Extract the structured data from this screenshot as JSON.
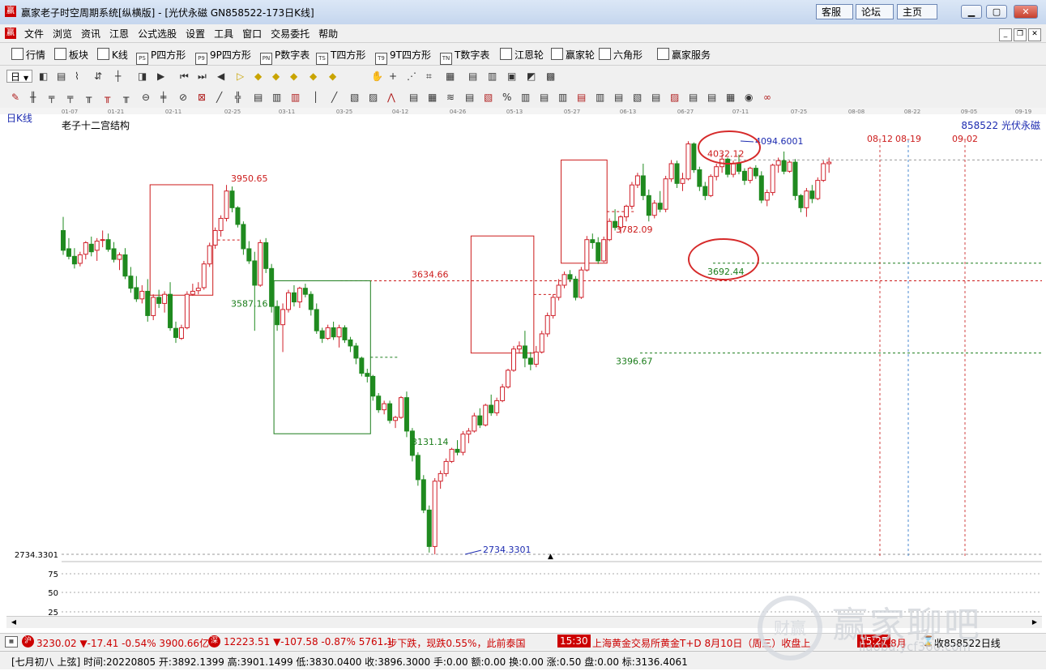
{
  "window": {
    "title": "赢家老子时空周期系统[纵横版] - [光伏永磁   GN858522-173日K线]",
    "logo_text": "赢",
    "buttons": [
      "客服",
      "论坛",
      "主页"
    ]
  },
  "menu": {
    "items": [
      "文件",
      "浏览",
      "资讯",
      "江恩",
      "公式选股",
      "设置",
      "工具",
      "窗口",
      "交易委托",
      "帮助"
    ]
  },
  "toolbar1": {
    "items": [
      {
        "label": "行情",
        "icon": "grid-icon"
      },
      {
        "label": "板块",
        "icon": "blocks-icon"
      },
      {
        "label": "K线",
        "icon": "candlestick-icon"
      },
      {
        "label": "P四方形",
        "icon": "ps-icon",
        "ic": "PS"
      },
      {
        "label": "9P四方形",
        "icon": "p9-icon",
        "ic": "P9"
      },
      {
        "label": "P数字表",
        "icon": "pn-icon",
        "ic": "PN"
      },
      {
        "label": "T四方形",
        "icon": "ts-icon",
        "ic": "TS"
      },
      {
        "label": "9T四方形",
        "icon": "t9-icon",
        "ic": "T9"
      },
      {
        "label": "T数字表",
        "icon": "tn-icon",
        "ic": "TN"
      },
      {
        "label": "江恩轮",
        "icon": "gann-wheel-icon"
      },
      {
        "label": "赢家轮",
        "icon": "winner-wheel-icon"
      },
      {
        "label": "六角形",
        "icon": "hexagon-icon"
      },
      {
        "label": "赢家服务",
        "icon": "dollar-icon"
      }
    ]
  },
  "toolbar2": {
    "period_label": "日"
  },
  "chart": {
    "period_label": "日K线",
    "structure_title": "老子十二宫结构",
    "stock_label": "858522 光伏永磁",
    "date_ticks": [
      "01-07",
      "01-21",
      "02-11",
      "02-25",
      "03-11",
      "03-25",
      "04-12",
      "04-26",
      "05-13",
      "05-27",
      "06-13",
      "06-27",
      "07-11",
      "07-25",
      "08-08",
      "08-22",
      "09-05",
      "09-19"
    ],
    "axis_min_label": "2734.3301",
    "vol_ticks": [
      "75",
      "50",
      "25"
    ],
    "annotations": {
      "a1": "3950.65",
      "a2": "3587.16",
      "a3": "3634.66",
      "a4": "3131.14",
      "a5": "3782.09",
      "a6": "3396.67",
      "a7": "4032.12",
      "a8": "3692.44",
      "a9": "4094.6001",
      "a10": "2734.3301"
    },
    "future_dates": [
      "08-12",
      "08-19",
      "09-02"
    ]
  },
  "chart_data": {
    "type": "candlestick",
    "ohlc": [
      [
        3800,
        3845,
        3720,
        3735
      ],
      [
        3740,
        3775,
        3705,
        3715
      ],
      [
        3715,
        3742,
        3675,
        3690
      ],
      [
        3692,
        3730,
        3682,
        3720
      ],
      [
        3722,
        3765,
        3705,
        3760
      ],
      [
        3755,
        3780,
        3715,
        3730
      ],
      [
        3735,
        3775,
        3700,
        3765
      ],
      [
        3768,
        3800,
        3745,
        3770
      ],
      [
        3770,
        3790,
        3730,
        3738
      ],
      [
        3740,
        3762,
        3695,
        3705
      ],
      [
        3705,
        3728,
        3670,
        3720
      ],
      [
        3720,
        3742,
        3640,
        3650
      ],
      [
        3650,
        3680,
        3595,
        3610
      ],
      [
        3612,
        3650,
        3565,
        3575
      ],
      [
        3575,
        3620,
        3560,
        3600
      ],
      [
        3600,
        3640,
        3500,
        3520
      ],
      [
        3520,
        3590,
        3505,
        3580
      ],
      [
        3580,
        3605,
        3545,
        3560
      ],
      [
        3560,
        3600,
        3530,
        3590
      ],
      [
        3590,
        3630,
        3470,
        3480
      ],
      [
        3478,
        3500,
        3430,
        3448
      ],
      [
        3445,
        3490,
        3440,
        3480
      ],
      [
        3480,
        3600,
        3475,
        3590
      ],
      [
        3590,
        3625,
        3585,
        3600
      ],
      [
        3602,
        3630,
        3590,
        3610
      ],
      [
        3612,
        3700,
        3605,
        3690
      ],
      [
        3690,
        3760,
        3680,
        3750
      ],
      [
        3752,
        3810,
        3740,
        3800
      ],
      [
        3800,
        3850,
        3780,
        3840
      ],
      [
        3840,
        3950,
        3830,
        3930
      ],
      [
        3930,
        3945,
        3860,
        3875
      ],
      [
        3875,
        3880,
        3810,
        3820
      ],
      [
        3820,
        3830,
        3720,
        3740
      ],
      [
        3740,
        3765,
        3690,
        3700
      ],
      [
        3700,
        3730,
        3470,
        3620
      ],
      [
        3620,
        3770,
        3615,
        3760
      ],
      [
        3760,
        3775,
        3660,
        3675
      ],
      [
        3675,
        3690,
        3530,
        3550
      ],
      [
        3550,
        3570,
        3470,
        3490
      ],
      [
        3490,
        3560,
        3400,
        3540
      ],
      [
        3540,
        3605,
        3530,
        3595
      ],
      [
        3595,
        3620,
        3550,
        3565
      ],
      [
        3565,
        3615,
        3545,
        3610
      ],
      [
        3610,
        3625,
        3580,
        3590
      ],
      [
        3590,
        3600,
        3520,
        3540
      ],
      [
        3540,
        3560,
        3460,
        3470
      ],
      [
        3470,
        3480,
        3430,
        3445
      ],
      [
        3445,
        3490,
        3440,
        3480
      ],
      [
        3480,
        3500,
        3440,
        3450
      ],
      [
        3450,
        3490,
        3415,
        3480
      ],
      [
        3480,
        3488,
        3430,
        3440
      ],
      [
        3440,
        3450,
        3400,
        3420
      ],
      [
        3420,
        3430,
        3360,
        3380
      ],
      [
        3380,
        3385,
        3320,
        3330
      ],
      [
        3330,
        3345,
        3300,
        3320
      ],
      [
        3320,
        3325,
        3240,
        3255
      ],
      [
        3255,
        3265,
        3200,
        3210
      ],
      [
        3210,
        3240,
        3195,
        3230
      ],
      [
        3230,
        3240,
        3165,
        3175
      ],
      [
        3175,
        3190,
        3150,
        3185
      ],
      [
        3185,
        3255,
        3180,
        3250
      ],
      [
        3250,
        3270,
        3120,
        3140
      ],
      [
        3140,
        3150,
        3040,
        3060
      ],
      [
        3060,
        3070,
        2960,
        2980
      ],
      [
        2980,
        2995,
        2870,
        2880
      ],
      [
        2880,
        2895,
        2740,
        2760
      ],
      [
        2760,
        2985,
        2734,
        2975
      ],
      [
        2975,
        3010,
        2950,
        3000
      ],
      [
        3000,
        3050,
        2990,
        3040
      ],
      [
        3040,
        3085,
        3035,
        3080
      ],
      [
        3080,
        3110,
        3060,
        3070
      ],
      [
        3070,
        3140,
        3060,
        3130
      ],
      [
        3130,
        3150,
        3100,
        3140
      ],
      [
        3140,
        3200,
        3135,
        3190
      ],
      [
        3190,
        3215,
        3150,
        3160
      ],
      [
        3160,
        3230,
        3155,
        3225
      ],
      [
        3225,
        3260,
        3190,
        3200
      ],
      [
        3200,
        3250,
        3190,
        3240
      ],
      [
        3240,
        3295,
        3235,
        3285
      ],
      [
        3285,
        3345,
        3280,
        3340
      ],
      [
        3340,
        3420,
        3335,
        3410
      ],
      [
        3410,
        3435,
        3395,
        3420
      ],
      [
        3420,
        3470,
        3350,
        3380
      ],
      [
        3380,
        3400,
        3340,
        3360
      ],
      [
        3360,
        3420,
        3350,
        3400
      ],
      [
        3400,
        3470,
        3395,
        3460
      ],
      [
        3460,
        3530,
        3450,
        3520
      ],
      [
        3520,
        3590,
        3510,
        3580
      ],
      [
        3580,
        3640,
        3570,
        3620
      ],
      [
        3620,
        3665,
        3610,
        3655
      ],
      [
        3655,
        3670,
        3630,
        3640
      ],
      [
        3640,
        3650,
        3570,
        3580
      ],
      [
        3580,
        3680,
        3575,
        3670
      ],
      [
        3670,
        3782,
        3665,
        3770
      ],
      [
        3770,
        3790,
        3740,
        3760
      ],
      [
        3760,
        3778,
        3690,
        3700
      ],
      [
        3700,
        3780,
        3695,
        3770
      ],
      [
        3770,
        3840,
        3765,
        3830
      ],
      [
        3830,
        3870,
        3800,
        3810
      ],
      [
        3810,
        3850,
        3790,
        3845
      ],
      [
        3845,
        3885,
        3830,
        3880
      ],
      [
        3880,
        3960,
        3870,
        3950
      ],
      [
        3950,
        3990,
        3940,
        3980
      ],
      [
        3980,
        4020,
        3900,
        3915
      ],
      [
        3915,
        3935,
        3830,
        3850
      ],
      [
        3850,
        3900,
        3840,
        3890
      ],
      [
        3890,
        3930,
        3860,
        3870
      ],
      [
        3870,
        3980,
        3860,
        3970
      ],
      [
        3970,
        4032,
        3960,
        4020
      ],
      [
        4020,
        4030,
        3940,
        3955
      ],
      [
        3955,
        3990,
        3930,
        3970
      ],
      [
        3970,
        4094,
        3965,
        4085
      ],
      [
        4085,
        4090,
        3990,
        4000
      ],
      [
        4000,
        4010,
        3930,
        3945
      ],
      [
        3945,
        3960,
        3900,
        3915
      ],
      [
        3915,
        3985,
        3910,
        3978
      ],
      [
        3978,
        4020,
        3965,
        4010
      ],
      [
        4010,
        4050,
        3990,
        4035
      ],
      [
        4035,
        4040,
        3975,
        3985
      ],
      [
        3985,
        4030,
        3975,
        4020
      ],
      [
        4020,
        4050,
        3985,
        3995
      ],
      [
        3995,
        4005,
        3950,
        3965
      ],
      [
        3965,
        4010,
        3955,
        4005
      ],
      [
        4005,
        4015,
        3970,
        3980
      ],
      [
        3980,
        3995,
        3890,
        3900
      ],
      [
        3900,
        3935,
        3880,
        3925
      ],
      [
        3925,
        4020,
        3915,
        4015
      ],
      [
        4015,
        4040,
        3990,
        4030
      ],
      [
        4030,
        4060,
        3985,
        3995
      ],
      [
        3995,
        4030,
        3990,
        4025
      ],
      [
        4025,
        4035,
        3900,
        3915
      ],
      [
        3915,
        3920,
        3860,
        3875
      ],
      [
        3875,
        3940,
        3845,
        3930
      ],
      [
        3930,
        3950,
        3890,
        3905
      ],
      [
        3905,
        3975,
        3900,
        3965
      ],
      [
        3965,
        4030,
        3960,
        4020
      ],
      [
        4020,
        4040,
        3990,
        4025
      ]
    ],
    "boxes": [
      {
        "start": 16,
        "end": 26,
        "high": 3950.65,
        "low": 3587.16,
        "color": "red"
      },
      {
        "start": 38,
        "end": 54,
        "high": 3634.66,
        "low": 3131.14,
        "color": "green"
      },
      {
        "start": 73,
        "end": 83,
        "high": 3782.09,
        "low": 3396.67,
        "color": "red"
      },
      {
        "start": 89,
        "end": 96,
        "high": 4032.12,
        "low": 3692.44,
        "color": "red"
      }
    ],
    "levels": [
      {
        "value": 3692.44,
        "color": "green"
      },
      {
        "value": 3634.66,
        "color": "red"
      },
      {
        "value": 3396.67,
        "color": "green"
      },
      {
        "value": 4032.12,
        "color": "gray"
      },
      {
        "value": 2734.3301,
        "color": "gray"
      }
    ]
  },
  "status_bar1": {
    "sh_icon": "沪",
    "sh_text": "3230.02 ▼-17.41 -0.54% 3900.66亿",
    "sz_icon": "深",
    "sz_text": "12223.51 ▼-107.58 -0.87% 5761.1",
    "ticker": "-步下跌，现跌0.55%，此前泰国",
    "time1": "15:30",
    "news": "上海黄金交易所黄金T+D 8月10日（周三）收盘上",
    "time2": "15:27",
    "month": "8月",
    "receiving": "收858522日线"
  },
  "status_bar2": {
    "text": "[七月初八  上弦] 时间:20220805 开:3892.1399 高:3901.1499 低:3830.0400 收:3896.3000 手:0.00 额:0.00 换:0.00 涨:0.50 盘:0.00 标:3136.4061"
  },
  "watermark": {
    "text": "赢家聊吧",
    "url": "liaoba.ycf360.com",
    "badge": "财赢"
  },
  "colors": {
    "up": "#d0202a",
    "down": "#1f8a1f",
    "box_red": "#cc1b1b",
    "box_green": "#1b7d1b",
    "date_blue": "#1c2bb0"
  }
}
